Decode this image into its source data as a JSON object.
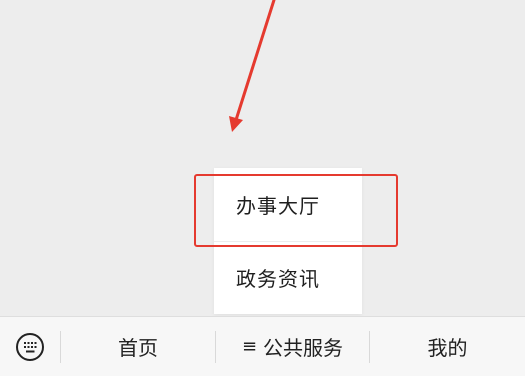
{
  "popup_menu": {
    "items": [
      {
        "label": "办事大厅"
      },
      {
        "label": "政务资讯"
      }
    ]
  },
  "bottom_bar": {
    "keyboard_icon": "keyboard-icon",
    "tabs": [
      {
        "label": "首页"
      },
      {
        "glyph": "≡",
        "label": "公共服务"
      },
      {
        "label": "我的"
      }
    ]
  },
  "annotation": {
    "color": "#e53a2f"
  }
}
